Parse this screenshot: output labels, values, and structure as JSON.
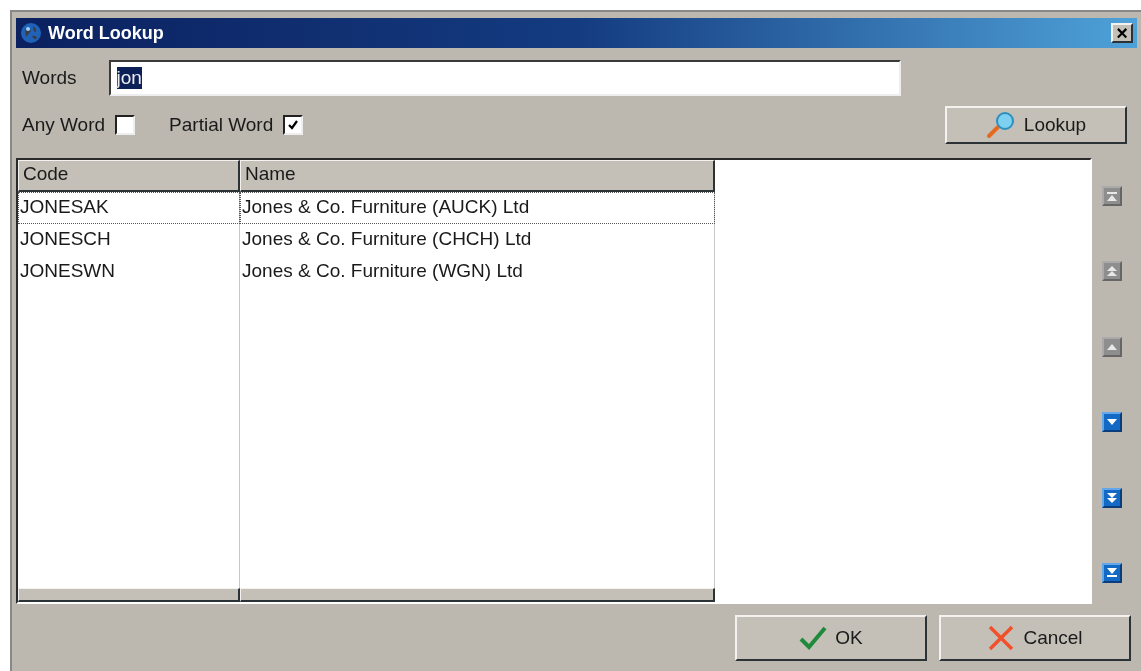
{
  "window": {
    "title": "Word Lookup",
    "close": "×"
  },
  "words": {
    "label": "Words",
    "value": "jon",
    "value_selected": true
  },
  "options": [
    {
      "label": "Any Word",
      "checked": false
    },
    {
      "label": "Partial Word",
      "checked": true
    }
  ],
  "lookup_button": "Lookup",
  "table": {
    "columns": [
      "Code",
      "Name"
    ],
    "rows": [
      {
        "cells": [
          "JONESAK",
          "Jones & Co. Furniture (AUCK) Ltd"
        ],
        "selected": true
      },
      {
        "cells": [
          "JONESCH",
          "Jones & Co. Furniture (CHCH) Ltd"
        ],
        "selected": false
      },
      {
        "cells": [
          "JONESWN",
          "Jones & Co. Furniture (WGN) Ltd"
        ],
        "selected": false
      }
    ]
  },
  "nav_buttons": [
    {
      "kind": "first",
      "disabled": true
    },
    {
      "kind": "page-up",
      "disabled": true
    },
    {
      "kind": "up",
      "disabled": true
    },
    {
      "kind": "down",
      "disabled": false
    },
    {
      "kind": "page-down",
      "disabled": false
    },
    {
      "kind": "last",
      "disabled": false
    }
  ],
  "buttons": [
    {
      "kind": "ok",
      "label": "OK"
    },
    {
      "kind": "cancel",
      "label": "Cancel"
    }
  ]
}
